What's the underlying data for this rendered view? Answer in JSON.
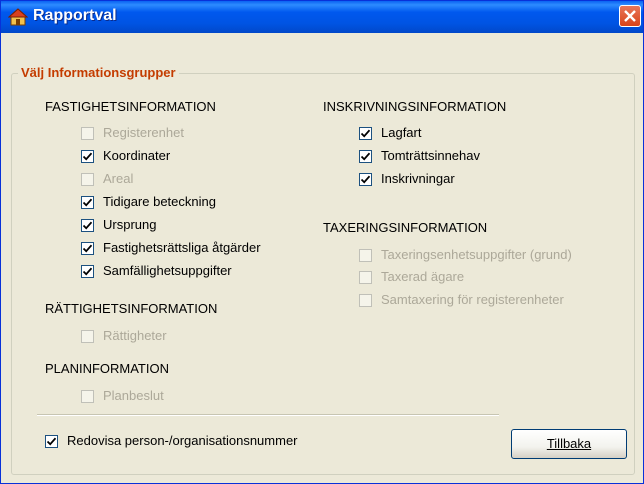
{
  "window": {
    "title": "Rapportval"
  },
  "group": {
    "title": "Välj Informationsgrupper"
  },
  "sections": {
    "fastighet": {
      "heading": "FASTIGHETSINFORMATION",
      "items": [
        {
          "label": "Registerenhet",
          "checked": false,
          "enabled": false
        },
        {
          "label": "Koordinater",
          "checked": true,
          "enabled": true
        },
        {
          "label": "Areal",
          "checked": false,
          "enabled": false
        },
        {
          "label": "Tidigare beteckning",
          "checked": true,
          "enabled": true
        },
        {
          "label": "Ursprung",
          "checked": true,
          "enabled": true
        },
        {
          "label": "Fastighetsrättsliga åtgärder",
          "checked": true,
          "enabled": true
        },
        {
          "label": "Samfällighetsuppgifter",
          "checked": true,
          "enabled": true
        }
      ]
    },
    "rattighet": {
      "heading": "RÄTTIGHETSINFORMATION",
      "items": [
        {
          "label": "Rättigheter",
          "checked": false,
          "enabled": false
        }
      ]
    },
    "plan": {
      "heading": "PLANINFORMATION",
      "items": [
        {
          "label": "Planbeslut",
          "checked": false,
          "enabled": false
        }
      ]
    },
    "inskrivning": {
      "heading": "INSKRIVNINGSINFORMATION",
      "items": [
        {
          "label": "Lagfart",
          "checked": true,
          "enabled": true
        },
        {
          "label": "Tomträttsinnehav",
          "checked": true,
          "enabled": true
        },
        {
          "label": "Inskrivningar",
          "checked": true,
          "enabled": true
        }
      ]
    },
    "taxering": {
      "heading": "TAXERINGSINFORMATION",
      "items": [
        {
          "label": "Taxeringsenhetsuppgifter (grund)",
          "checked": false,
          "enabled": false
        },
        {
          "label": "Taxerad ägare",
          "checked": false,
          "enabled": false
        },
        {
          "label": "Samtaxering för registerenheter",
          "checked": false,
          "enabled": false
        }
      ]
    }
  },
  "footer": {
    "show_numbers": {
      "label": "Redovisa person-/organisationsnummer",
      "checked": true,
      "enabled": true
    },
    "back_button": {
      "label": "Tillbaka"
    }
  },
  "icons": {
    "title": "house-icon",
    "close": "close-icon",
    "check": "checkmark-icon"
  },
  "colors": {
    "titlebar": "#0054e3",
    "group_title": "#c43c00",
    "disabled_text": "#aca899",
    "dialog_bg": "#ece9d8"
  }
}
